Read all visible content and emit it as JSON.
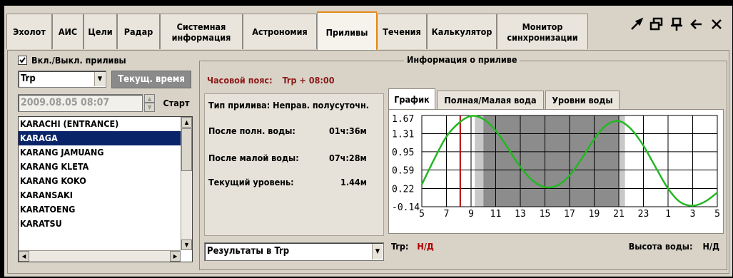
{
  "toolbar": {
    "tabs": [
      {
        "label": "Эхолот"
      },
      {
        "label": "АИС"
      },
      {
        "label": "Цели"
      },
      {
        "label": "Радар"
      },
      {
        "label": "Системная информация"
      },
      {
        "label": "Астрономия"
      },
      {
        "label": "Приливы"
      },
      {
        "label": "Течения"
      },
      {
        "label": "Калькулятор"
      },
      {
        "label": "Монитор синхронизации"
      }
    ],
    "active_tab": "Приливы",
    "window_icons": [
      "pin-tool-icon",
      "restore-window-icon",
      "dock-icon",
      "back-arrow-icon",
      "close-icon"
    ]
  },
  "left": {
    "enable_checkbox_label": "Вкл./Выкл. приливы",
    "enable_checked": true,
    "timezone_select_value": "Trp",
    "current_time_button": "Текущ. время",
    "datetime_value": "2009.08.05 08:07",
    "start_button": "Старт",
    "stations": [
      "KARACHI (ENTRANCE)",
      "KARAGA",
      "KARANG JAMUANG",
      "KARANG KLETA",
      "KARANG KOKO",
      "KARANSAKI",
      "KARATOENG",
      "KARATSU"
    ],
    "selected_station": "KARAGA"
  },
  "info": {
    "group_title": "Информация о приливе",
    "timezone_label": "Часовой пояс:",
    "timezone_value": "Trp + 08:00",
    "tide_type": "Тип прилива: Неправ. полусуточн.",
    "after_high_label": "После полн. воды:",
    "after_high_value": "01ч:36м",
    "after_low_label": "После малой воды:",
    "after_low_value": "07ч:28м",
    "current_level_label": "Текущий уровень:",
    "current_level_value": "1.44м",
    "results_select_value": "Результаты в Trp"
  },
  "chart_tabs": [
    "График",
    "Полная/Малая вода",
    "Уровни воды"
  ],
  "chart_footer": {
    "trp_label": "Trp:",
    "trp_value": "Н/Д",
    "height_label": "Высота воды:",
    "height_value": "Н/Д"
  },
  "chart_data": {
    "type": "line",
    "y_ticks": [
      "1.67",
      "1.31",
      "0.95",
      "0.59",
      "0.22",
      "-0.14"
    ],
    "x_ticks": [
      "5",
      "7",
      "9",
      "11",
      "13",
      "15",
      "17",
      "19",
      "21",
      "23",
      "1",
      "3",
      "5"
    ],
    "ylim": [
      -0.14,
      1.67
    ],
    "xlim": [
      5,
      29
    ],
    "series": [
      {
        "color": "#22b822",
        "x": [
          5,
          6,
          7,
          8,
          9,
          10,
          11,
          12,
          13,
          14,
          15,
          16,
          17,
          18,
          19,
          20,
          21,
          22,
          23,
          24,
          25,
          26,
          27,
          28,
          29
        ],
        "y": [
          0.3,
          0.8,
          1.25,
          1.52,
          1.66,
          1.6,
          1.37,
          1.02,
          0.65,
          0.38,
          0.25,
          0.28,
          0.48,
          0.82,
          1.2,
          1.48,
          1.56,
          1.4,
          1.07,
          0.64,
          0.22,
          -0.05,
          -0.12,
          -0.04,
          0.14
        ]
      }
    ],
    "current_time_x": 8.12,
    "current_time_color": "#b00000",
    "night_shading": [
      [
        10,
        21
      ]
    ],
    "twilight_shading": [
      [
        9.3,
        10
      ],
      [
        21,
        21.5
      ]
    ],
    "grid": true
  }
}
